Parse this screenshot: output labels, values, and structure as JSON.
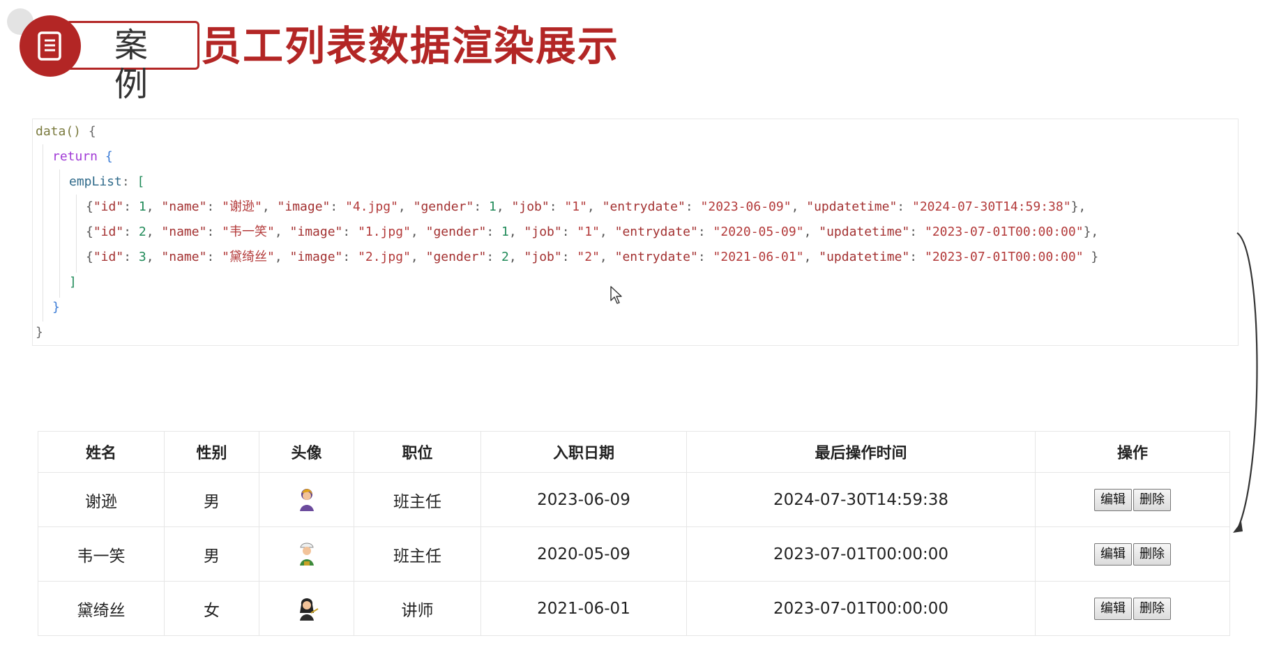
{
  "header": {
    "badge_label": "案例",
    "title": "员工列表数据渲染展示"
  },
  "code": {
    "data_fn": "data()",
    "open_brace": "{",
    "return_kw": "return",
    "return_brace": "{",
    "list_name": "empList",
    "list_colon": ":",
    "list_open": "[",
    "rows": [
      {
        "id": "1",
        "name": "\"谢逊\"",
        "image": "\"4.jpg\"",
        "gender": "1",
        "job": "\"1\"",
        "entrydate": "\"2023-06-09\"",
        "updatetime": "\"2024-07-30T14:59:38\"",
        "end": "},"
      },
      {
        "id": "2",
        "name": "\"韦一笑\"",
        "image": "\"1.jpg\"",
        "gender": "1",
        "job": "\"1\"",
        "entrydate": "\"2020-05-09\"",
        "updatetime": "\"2023-07-01T00:00:00\"",
        "end": "},"
      },
      {
        "id": "3",
        "name": "\"黛绮丝\"",
        "image": "\"2.jpg\"",
        "gender": "2",
        "job": "\"2\"",
        "entrydate": "\"2021-06-01\"",
        "updatetime": "\"2023-07-01T00:00:00\"",
        "end": "}"
      }
    ],
    "keys": {
      "id": "\"id\"",
      "name": "\"name\"",
      "image": "\"image\"",
      "gender": "\"gender\"",
      "job": "\"job\"",
      "entrydate": "\"entrydate\"",
      "updatetime": "\"updatetime\""
    },
    "list_close": "]",
    "return_close": "}",
    "fn_close": "}"
  },
  "table": {
    "headers": [
      "姓名",
      "性别",
      "头像",
      "职位",
      "入职日期",
      "最后操作时间",
      "操作"
    ],
    "rows": [
      {
        "name": "谢逊",
        "gender": "男",
        "avatar": "avatar-icon",
        "job": "班主任",
        "entrydate": "2023-06-09",
        "updatetime": "2024-07-30T14:59:38"
      },
      {
        "name": "韦一笑",
        "gender": "男",
        "avatar": "avatar-icon",
        "job": "班主任",
        "entrydate": "2020-05-09",
        "updatetime": "2023-07-01T00:00:00"
      },
      {
        "name": "黛绮丝",
        "gender": "女",
        "avatar": "avatar-icon",
        "job": "讲师",
        "entrydate": "2021-06-01",
        "updatetime": "2023-07-01T00:00:00"
      }
    ],
    "edit_label": "编辑",
    "delete_label": "删除"
  },
  "colors": {
    "brand_red": "#b32625"
  },
  "icons": {
    "badge": "document-icon",
    "cursor": "mouse-cursor-icon",
    "arrow": "curved-arrow-icon"
  }
}
